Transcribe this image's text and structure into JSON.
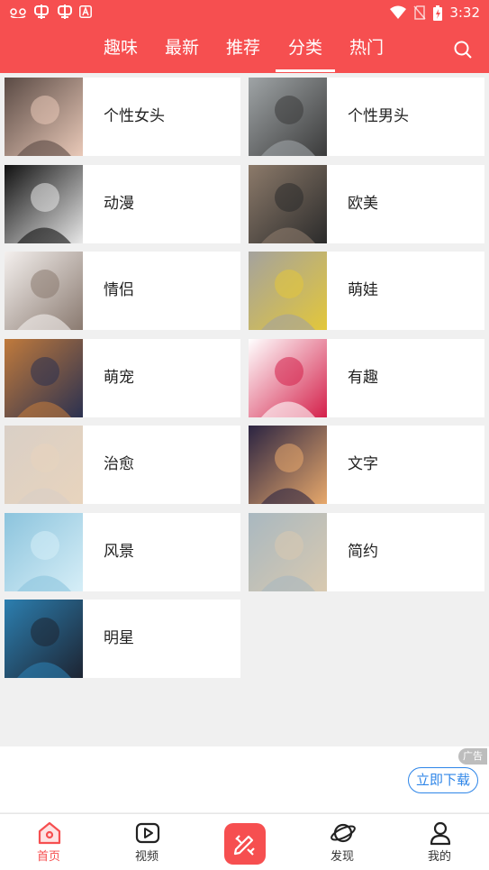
{
  "status_bar": {
    "time": "3:32"
  },
  "top_nav": {
    "tabs": [
      {
        "label": "趣味"
      },
      {
        "label": "最新"
      },
      {
        "label": "推荐"
      },
      {
        "label": "分类"
      },
      {
        "label": "热门"
      }
    ],
    "active_tab": "分类",
    "search_icon": "search-icon"
  },
  "categories": [
    {
      "label": "个性女头",
      "thumb_colors": [
        "#5a4a44",
        "#e9c9b8"
      ]
    },
    {
      "label": "个性男头",
      "thumb_colors": [
        "#9fa4a6",
        "#3b3b3b"
      ]
    },
    {
      "label": "动漫",
      "thumb_colors": [
        "#111111",
        "#e8e8e8"
      ]
    },
    {
      "label": "欧美",
      "thumb_colors": [
        "#8c7a6a",
        "#2b2b2b"
      ]
    },
    {
      "label": "情侣",
      "thumb_colors": [
        "#f4f0ee",
        "#8a7a70"
      ]
    },
    {
      "label": "萌娃",
      "thumb_colors": [
        "#a4a29e",
        "#e3c73a"
      ]
    },
    {
      "label": "萌宠",
      "thumb_colors": [
        "#c07a3c",
        "#2b3150"
      ]
    },
    {
      "label": "有趣",
      "thumb_colors": [
        "#ffffff",
        "#d4204a"
      ]
    },
    {
      "label": "治愈",
      "thumb_colors": [
        "#d9cfc6",
        "#e8d4bd"
      ]
    },
    {
      "label": "文字",
      "thumb_colors": [
        "#2b2442",
        "#e7a86b"
      ]
    },
    {
      "label": "风景",
      "thumb_colors": [
        "#8cc4dd",
        "#d6eef7"
      ]
    },
    {
      "label": "简约",
      "thumb_colors": [
        "#a9b8c0",
        "#d8c9b0"
      ]
    },
    {
      "label": "明星",
      "thumb_colors": [
        "#2c7fb0",
        "#1d2432"
      ]
    }
  ],
  "ad": {
    "tag": "广告",
    "button": "立即下载"
  },
  "bottom_nav": {
    "items": [
      {
        "label": "首页",
        "icon": "home-icon"
      },
      {
        "label": "视频",
        "icon": "video-icon"
      },
      {
        "label": "",
        "icon": "edit-icon"
      },
      {
        "label": "发现",
        "icon": "planet-icon"
      },
      {
        "label": "我的",
        "icon": "user-icon"
      }
    ],
    "active": "首页"
  },
  "colors": {
    "brand": "#f64f50",
    "link": "#2f86e8",
    "background": "#f0f0f0"
  }
}
